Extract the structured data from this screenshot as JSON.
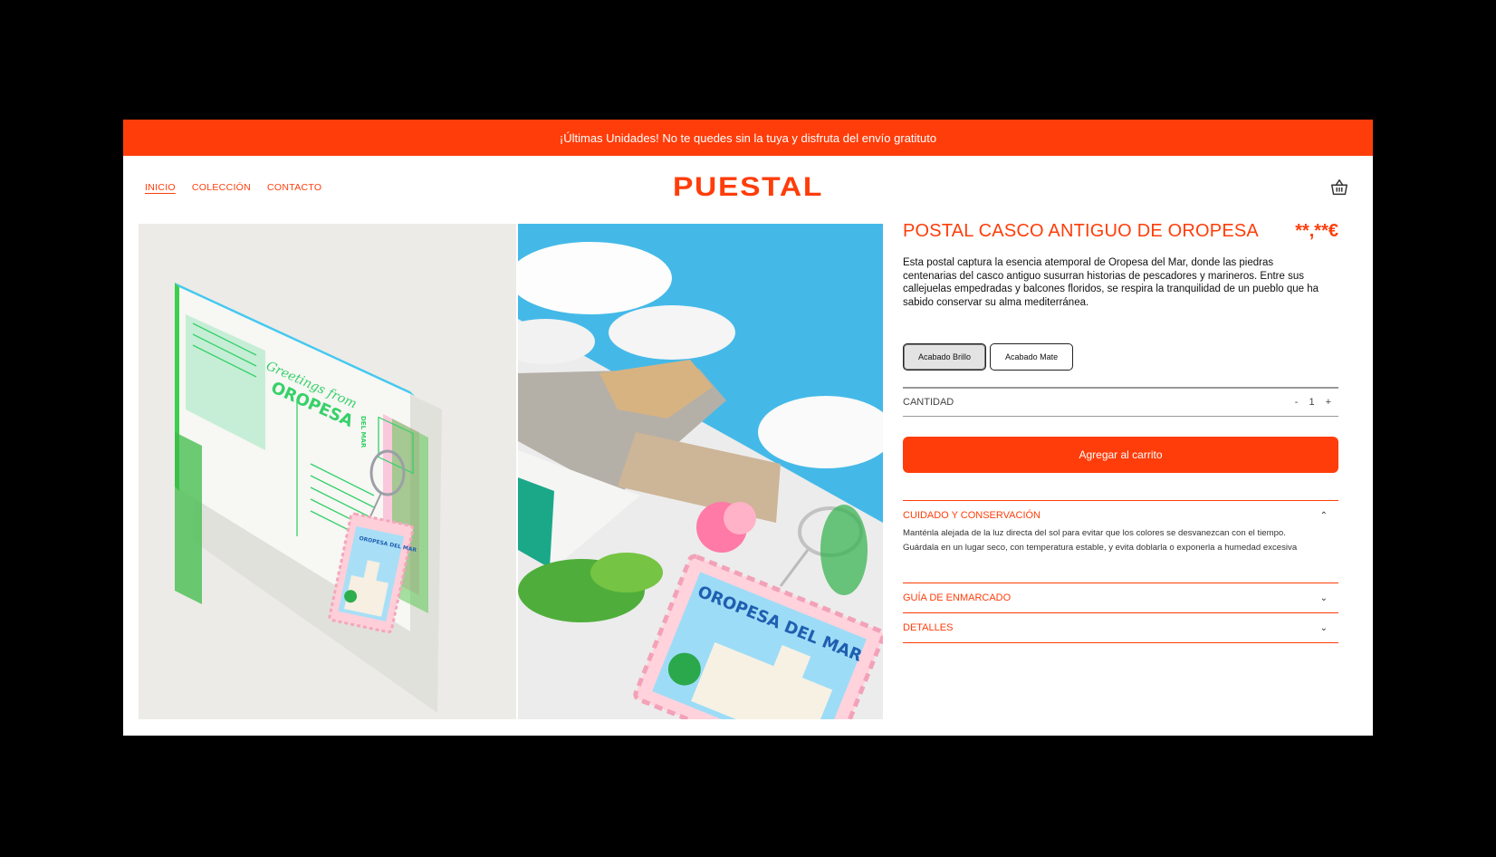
{
  "promo": {
    "text": "¡Últimas Unidades! No te quedes sin la tuya y disfruta del envío gratituto"
  },
  "nav": {
    "items": [
      "INICIO",
      "COLECCIÓN",
      "CONTACTO"
    ]
  },
  "brand": {
    "logo": "PUESTAL",
    "accent": "#ff3d0a"
  },
  "cart": {
    "icon": "basket-icon"
  },
  "gallery": {
    "postcard_greeting": "Greetings from",
    "postcard_town": "OROPESA",
    "postcard_suffix": "DEL MAR",
    "stamp_text": "OROPESA DEL MAR"
  },
  "product": {
    "title": "POSTAL CASCO ANTIGUO DE OROPESA",
    "price": "**,**€",
    "description": "Esta postal captura la esencia atemporal de Oropesa del Mar, donde las piedras centenarias del casco antiguo susurran historias de pescadores y marineros. Entre sus callejuelas empedradas y balcones floridos, se respira la tranquilidad de un pueblo que ha sabido conservar su alma mediterránea.",
    "finishes": [
      "Acabado Brillo",
      "Acabado Mate"
    ],
    "selected_finish": "Acabado Brillo",
    "quantity_label": "CANTIDAD",
    "quantity": "1",
    "minus": "-",
    "plus": "+",
    "add_to_cart": "Agregar al carrito"
  },
  "accordions": [
    {
      "title": "CUIDADO Y CONSERVACIÓN",
      "expanded": true,
      "body": "Manténla alejada de la luz directa del sol para evitar que los colores se desvanezcan con el tiempo. Guárdala en un lugar seco, con temperatura estable, y evita doblarla o exponerla a humedad excesiva"
    },
    {
      "title": "GUÍA DE ENMARCADO",
      "expanded": false
    },
    {
      "title": "DETALLES",
      "expanded": false
    }
  ]
}
